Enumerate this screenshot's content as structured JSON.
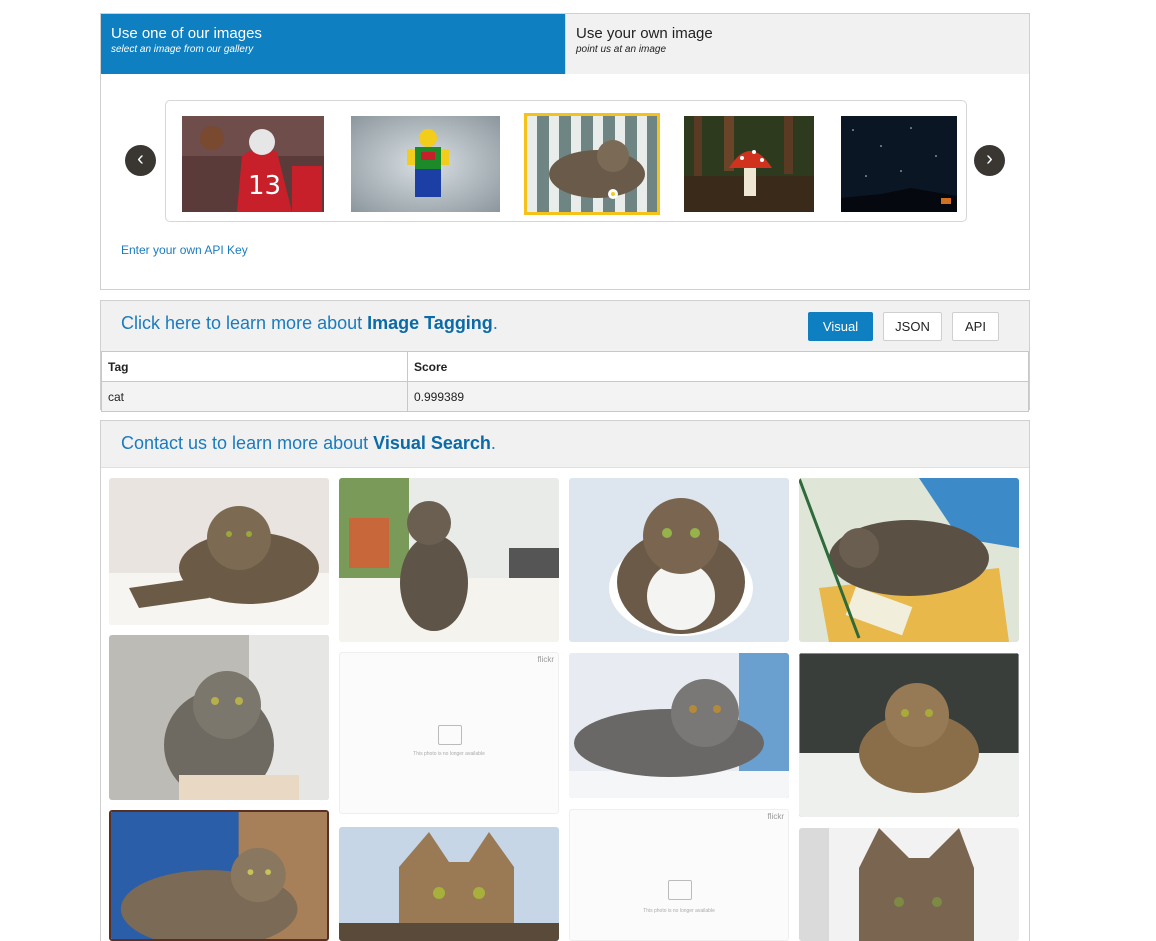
{
  "tabs": [
    {
      "title": "Use one of our images",
      "subtitle": "select an image from our gallery"
    },
    {
      "title": "Use your own image",
      "subtitle": "point us at an image"
    }
  ],
  "carousel": {
    "prev_icon": "‹",
    "next_icon": "›",
    "thumbs": [
      "football-player",
      "lego-figure",
      "cat-selected",
      "mushroom",
      "night-sky"
    ]
  },
  "api_link": "Enter your own API Key",
  "tagging": {
    "learn_prefix": "Click here to learn more about ",
    "learn_strong": "Image Tagging",
    "learn_suffix": ".",
    "buttons": [
      "Visual",
      "JSON",
      "API"
    ],
    "columns": [
      "Tag",
      "Score"
    ],
    "rows": [
      {
        "tag": "cat",
        "score": "0.999389"
      }
    ]
  },
  "visual_search": {
    "prefix": "Contact us to learn more about ",
    "strong": "Visual Search",
    "suffix": ".",
    "unavailable": {
      "brand": "flickr",
      "text": "This photo is no longer available"
    }
  },
  "colors": {
    "accent": "#0e7fc0",
    "selected_outline": "#f5c21a"
  }
}
